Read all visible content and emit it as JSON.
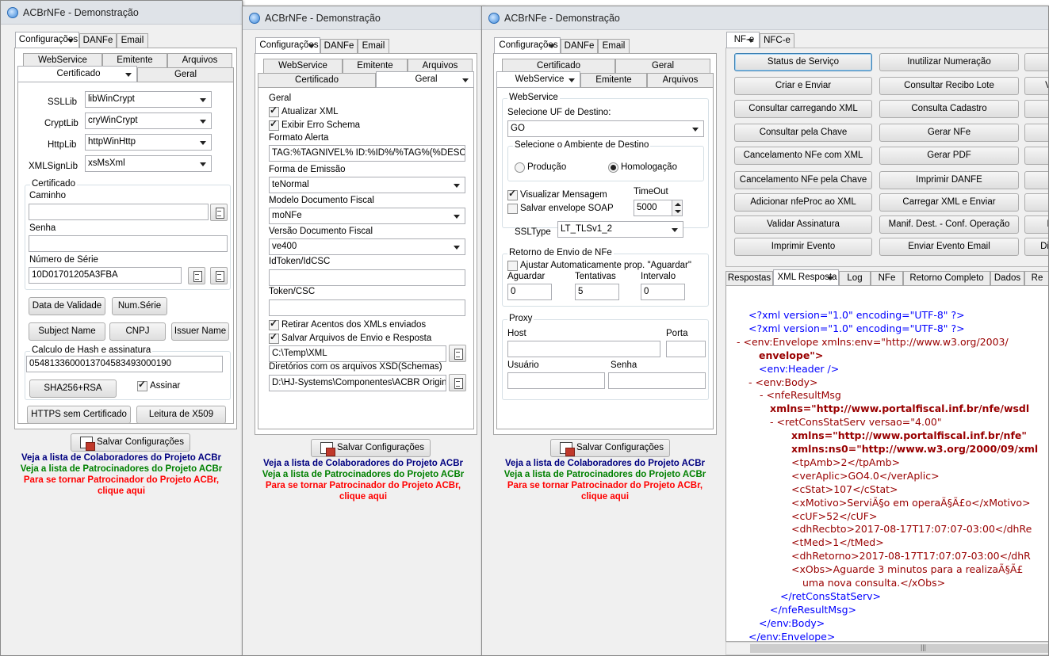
{
  "title": "ACBrNFe - Demonstração",
  "main_tabs": {
    "config": "Configurações",
    "danfe": "DANFe",
    "email": "Email"
  },
  "sub_tabs": {
    "webservice": "WebService",
    "emitente": "Emitente",
    "arquivos": "Arquivos",
    "certificado": "Certificado",
    "geral": "Geral"
  },
  "win1": {
    "ssllib_label": "SSLLib",
    "ssllib": "libWinCrypt",
    "cryptlib_label": "CryptLib",
    "cryptlib": "cryWinCrypt",
    "httplib_label": "HttpLib",
    "httplib": "httpWinHttp",
    "xmlsign_label": "XMLSignLib",
    "xmlsign": "xsMsXml",
    "cert_group": "Certificado",
    "caminho_label": "Caminho",
    "caminho": "",
    "senha_label": "Senha",
    "senha": "",
    "serie_label": "Número de Série",
    "serie": "10D01701205A3FBA",
    "btn_validade": "Data de Validade",
    "btn_numserie": "Num.Série",
    "btn_subject": "Subject Name",
    "btn_cnpj": "CNPJ",
    "btn_issuer": "Issuer Name",
    "hash_group": "Calculo de Hash e assinatura",
    "hash_value": "05481336000137045834930001​90",
    "btn_sha": "SHA256+RSA",
    "assinar": "Assinar",
    "btn_https": "HTTPS sem Certificado",
    "btn_x509": "Leitura de X509"
  },
  "win2": {
    "geral_group": "Geral",
    "atualizar_xml": "Atualizar XML",
    "exibir_erro": "Exibir Erro Schema",
    "formato_label": "Formato Alerta",
    "formato": "TAG:%TAGNIVEL% ID:%ID%/%TAG%(%DESCRICA",
    "forma_label": "Forma de Emissão",
    "forma": "teNormal",
    "modelo_label": "Modelo Documento Fiscal",
    "modelo": "moNFe",
    "versao_label": "Versão Documento Fiscal",
    "versao": "ve400",
    "idtoken_label": "IdToken/IdCSC",
    "idtoken": "",
    "token_label": "Token/CSC",
    "token": "",
    "retirar": "Retirar Acentos dos XMLs enviados",
    "salvar_arquivos": "Salvar Arquivos de Envio e Resposta",
    "salvar_path": "C:\\Temp\\XML",
    "xsd_label": "Diretórios com os arquivos XSD(Schemas)",
    "xsd_path": "D:\\HJ-Systems\\Componentes\\ACBR Original\\E"
  },
  "win3": {
    "ws_group": "WebService",
    "uf_label": "Selecione UF de Destino:",
    "uf": "GO",
    "amb_group": "Selecione o Ambiente de Destino",
    "producao": "Produção",
    "homologacao": "Homologação",
    "visualizar": "Visualizar Mensagem",
    "salvar_soap": "Salvar envelope SOAP",
    "timeout_label": "TimeOut",
    "timeout": "5000",
    "ssltype_label": "SSLType",
    "ssltype": "LT_TLSv1_2",
    "retorno_group": "Retorno de Envio de NFe",
    "ajustar": "Ajustar Automaticamente prop. \"Aguardar\"",
    "aguardar_label": "Aguardar",
    "aguardar": "0",
    "tentativas_label": "Tentativas",
    "tentativas": "5",
    "intervalo_label": "Intervalo",
    "intervalo": "0",
    "proxy_group": "Proxy",
    "host_label": "Host",
    "porta_label": "Porta",
    "usuario_label": "Usuário",
    "senha_label": "Senha"
  },
  "footer": {
    "save": "Salvar Configurações",
    "colab": "Veja a lista de Colaboradores do Projeto ACBr",
    "patroc": "Veja a lista de Patrocinadores do Projeto ACBr",
    "torne1": "Para se tornar Patrocinador do Projeto ACBr,",
    "torne2": "clique aqui"
  },
  "right": {
    "tab_nfe": "NF-e",
    "tab_nfce": "NFC-e",
    "buttons_col1": [
      "Status de Serviço",
      "Criar e Enviar",
      "Consultar carregando XML",
      "Consultar pela Chave",
      "Cancelamento NFe com XML",
      "Cancelamento NFe pela Chave",
      "Adicionar nfeProc ao XML",
      "Validar Assinatura",
      "Imprimir Evento"
    ],
    "buttons_col2": [
      "Inutilizar Numeração",
      "Consultar Recibo Lote",
      "Consulta Cadastro",
      "Gerar NFe",
      "Gerar PDF",
      "Imprimir DANFE",
      "Carregar XML e Enviar",
      "Manif. Dest. - Conf. Operação",
      "Enviar Evento Email"
    ],
    "buttons_col3": [
      "",
      "V",
      "",
      "",
      "",
      "",
      "",
      "I",
      "Dist"
    ],
    "resp_tabs": [
      "Respostas",
      "XML Resposta",
      "Log",
      "NFe",
      "Retorno Completo WS",
      "Dados",
      "Re"
    ],
    "xml_lines": [
      "<?xml version=\"1.0\" encoding=\"UTF-8\" ?>",
      "<?xml version=\"1.0\" encoding=\"UTF-8\" ?>",
      "- <env:Envelope xmlns:env=\"http://www.w3.org/2003/",
      "envelope\">",
      "<env:Header />",
      "- <env:Body>",
      "- <nfeResultMsg",
      "xmlns=\"http://www.portalfiscal.inf.br/nfe/wsdl",
      "- <retConsStatServ versao=\"4.00\"",
      "xmlns=\"http://www.portalfiscal.inf.br/nfe\"",
      "xmlns:ns0=\"http://www.w3.org/2000/09/xml",
      "<tpAmb>2</tpAmb>",
      "<verAplic>GO4.0</verAplic>",
      "<cStat>107</cStat>",
      "<xMotivo>ServiÃ§o em operaÃ§Ã£o</xMotivo>",
      "<cUF>52</cUF>",
      "<dhRecbto>2017-08-17T17:07:07-03:00</dhRe",
      "<tMed>1</tMed>",
      "<dhRetorno>2017-08-17T17:07:07-03:00</dhR",
      "<xObs>Aguarde 3 minutos para a realizaÃ§Ã£",
      "uma nova consulta.</xObs>",
      "</retConsStatServ>",
      "</nfeResultMsg>",
      "</env:Body>",
      "</env:Envelope>"
    ]
  }
}
